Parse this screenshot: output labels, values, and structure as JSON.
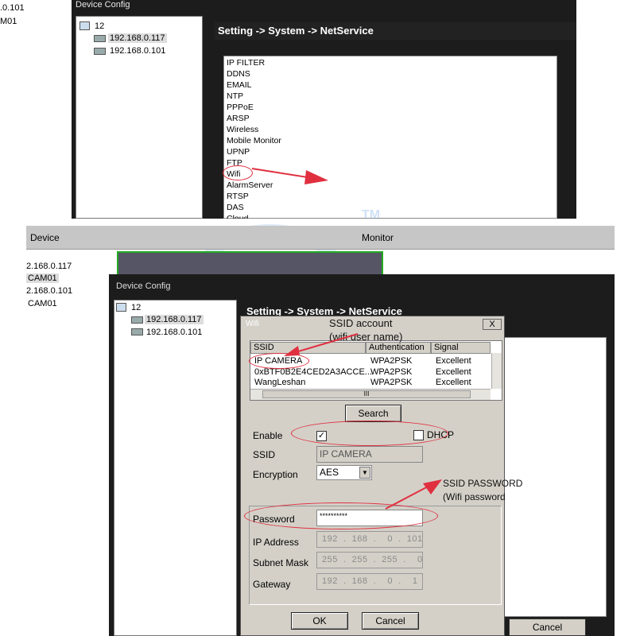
{
  "top": {
    "left_fragments": [
      ".0.101",
      "M01"
    ],
    "window_title": "Device Config",
    "tree_root": "12",
    "tree_items": [
      "192.168.0.117",
      "192.168.0.101"
    ],
    "breadcrumb": "Setting -> System -> NetService",
    "services": [
      "IP FILTER",
      "DDNS",
      "EMAIL",
      "NTP",
      "PPPoE",
      "ARSP",
      "Wireless",
      "Mobile Monitor",
      "UPNP",
      "FTP",
      "Wifi",
      "AlarmServer",
      "RTSP",
      "DAS",
      "Cloud"
    ]
  },
  "bottom": {
    "header_device": "Device",
    "header_monitor": "Monitor",
    "left_items": [
      "2.168.0.117",
      "CAM01",
      "2.168.0.101",
      "CAM01"
    ],
    "window_title": "Device Config",
    "tree_root": "12",
    "tree_items": [
      "192.168.0.117",
      "192.168.0.101"
    ],
    "breadcrumb": "Setting -> System -> NetService",
    "cancel_label": "Cancel"
  },
  "wifi": {
    "title": "Wifi",
    "close_label": "X",
    "columns": [
      "SSID",
      "Authentication",
      "Signal"
    ],
    "networks": [
      {
        "ssid": "IP CAMERA",
        "auth": "WPA2PSK",
        "signal": "Excellent"
      },
      {
        "ssid": "0xBTF0B2E4CED2A3ACCE...",
        "auth": "WPA2PSK",
        "signal": "Excellent"
      },
      {
        "ssid": "WangLeshan",
        "auth": "WPA2PSK",
        "signal": "Excellent"
      }
    ],
    "scroll_grip": "III",
    "search_label": "Search",
    "enable_label": "Enable",
    "enable_checked": "✓",
    "dhcp_label": "DHCP",
    "ssid_label": "SSID",
    "ssid_value": "IP CAMERA",
    "encryption_label": "Encryption",
    "encryption_value": "AES",
    "password_label": "Password",
    "password_value": "**********",
    "ip_label": "IP Address",
    "ip_value": "192  .  168  .    0  .  101",
    "mask_label": "Subnet Mask",
    "mask_value": "255  .  255  .  255  .    0",
    "gateway_label": "Gateway",
    "gateway_value": "192  .  168  .    0  .    1",
    "ok_label": "OK",
    "cancel_label": "Cancel"
  },
  "annotations": {
    "ssid_title": "SSID account",
    "ssid_sub": "(wifi user name)",
    "pwd_title": "SSID PASSWORD",
    "pwd_sub": "(Wifi password",
    "accent": "#e03040"
  },
  "watermark": "TM"
}
